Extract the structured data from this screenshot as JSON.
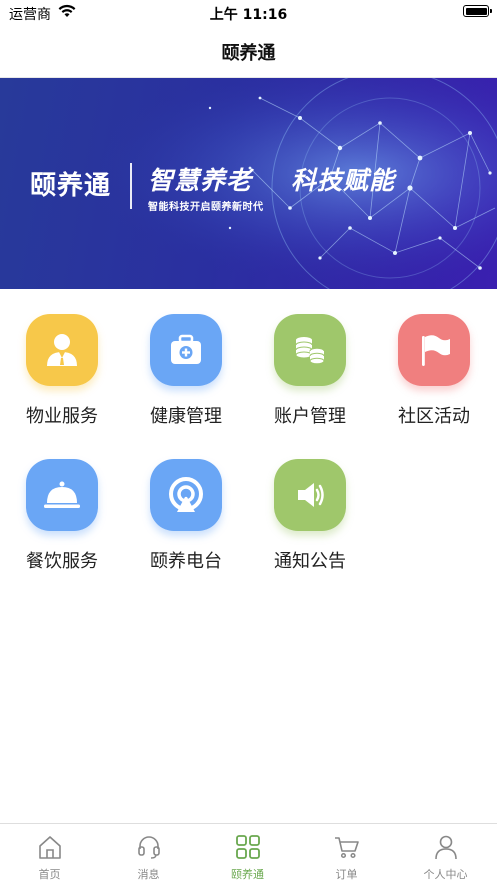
{
  "status_bar": {
    "carrier": "运营商",
    "time": "上午 11:16"
  },
  "nav": {
    "title": "颐养通"
  },
  "banner": {
    "brand": "颐养通",
    "slogan_1": "智慧养老",
    "slogan_2": "科技赋能",
    "subtitle": "智能科技开启颐养新时代"
  },
  "services": [
    {
      "label": "物业服务",
      "icon": "property-service-icon",
      "color": "#f7c84a"
    },
    {
      "label": "健康管理",
      "icon": "health-kit-icon",
      "color": "#6aa6f5"
    },
    {
      "label": "账户管理",
      "icon": "coins-icon",
      "color": "#9fc76b"
    },
    {
      "label": "社区活动",
      "icon": "flag-icon",
      "color": "#f07f7f"
    },
    {
      "label": "餐饮服务",
      "icon": "food-cloche-icon",
      "color": "#6aa6f5"
    },
    {
      "label": "颐养电台",
      "icon": "radio-icon",
      "color": "#6aa6f5"
    },
    {
      "label": "通知公告",
      "icon": "speaker-icon",
      "color": "#9fc76b"
    }
  ],
  "tabs": [
    {
      "label": "首页",
      "icon": "home-icon",
      "active": false
    },
    {
      "label": "消息",
      "icon": "headset-icon",
      "active": false
    },
    {
      "label": "颐养通",
      "icon": "grid-icon",
      "active": true
    },
    {
      "label": "订单",
      "icon": "cart-icon",
      "active": false
    },
    {
      "label": "个人中心",
      "icon": "person-icon",
      "active": false
    }
  ],
  "colors": {
    "accent": "#6aa84f",
    "banner_dark": "#283a9a",
    "banner_light": "#3a1fb0"
  }
}
